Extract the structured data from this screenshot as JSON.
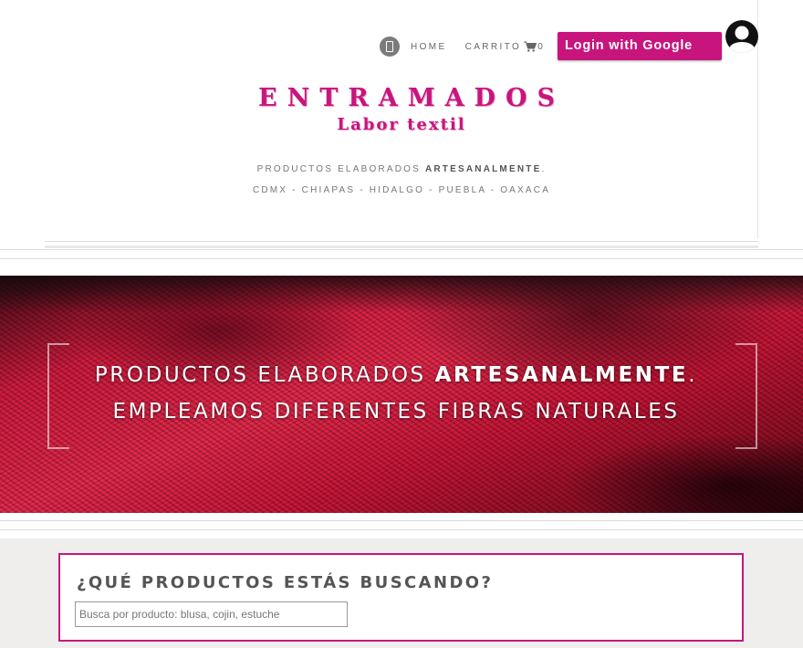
{
  "header": {
    "nav": {
      "home_label": "HOME",
      "cart_label": "CARRITO",
      "cart_count": "0"
    },
    "login_label": "Login with Google",
    "brand_title": "ENTRAMADOS",
    "brand_subtitle": "Labor textil",
    "tagline_prefix": "PRODUCTOS ELABORADOS ",
    "tagline_strong": "ARTESANALMENTE",
    "tagline_suffix": ".",
    "regions": "CDMX - CHIAPAS - HIDALGO - PUEBLA - OAXACA"
  },
  "hero": {
    "line1_prefix": "PRODUCTOS ELABORADOS ",
    "line1_strong": "ARTESANALMENTE",
    "line1_suffix": ".",
    "line2": "EMPLEAMOS DIFERENTES FIBRAS NATURALES"
  },
  "search": {
    "title": "¿QUÉ PRODUCTOS ESTÁS BUSCANDO?",
    "placeholder": "Busca por producto: blusa, cojin, estuche",
    "value": ""
  },
  "colors": {
    "brand": "#c8157d",
    "muted_text": "#777777",
    "search_bg": "#efeeec"
  },
  "icons": {
    "menu": "mobile-menu-icon",
    "cart": "shopping-cart-icon",
    "avatar": "user-avatar-icon"
  }
}
